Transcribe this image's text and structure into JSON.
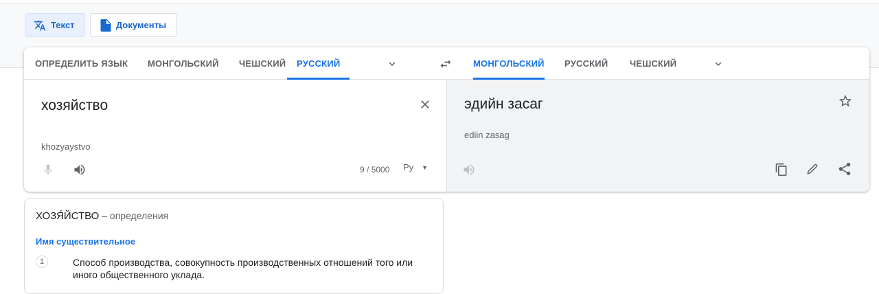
{
  "modes": {
    "text_label": "Текст",
    "docs_label": "Документы"
  },
  "source_langs": [
    "ОПРЕДЕЛИТЬ ЯЗЫК",
    "МОНГОЛЬСКИЙ",
    "ЧЕШСКИЙ",
    "РУССКИЙ"
  ],
  "target_langs": [
    "МОНГОЛЬСКИЙ",
    "РУССКИЙ",
    "ЧЕШСКИЙ"
  ],
  "source": {
    "text": "хозяйство",
    "transliteration": "khozyaystvo",
    "char_count": "9 / 5000",
    "keyboard": "Ру"
  },
  "target": {
    "text": "эдийн засаг",
    "transliteration": "ediin zasag"
  },
  "definitions": {
    "word": "ХОЗЯ́ЙСТВО",
    "suffix": " – определения",
    "part_of_speech": "Имя существительное",
    "items": [
      {
        "num": "1",
        "text": "Способ производства, совокупность производственных отношений того или иного общественного уклада."
      }
    ]
  },
  "colors": {
    "accent": "#1a73e8",
    "active_mode_bg": "#e8f0fe",
    "target_panel_bg": "#f1f3f4"
  },
  "icons": [
    "translate-icon",
    "document-icon",
    "chevron-down-icon",
    "swap-icon",
    "close-icon",
    "mic-icon",
    "speaker-icon",
    "star-icon",
    "copy-icon",
    "edit-icon",
    "share-icon"
  ]
}
